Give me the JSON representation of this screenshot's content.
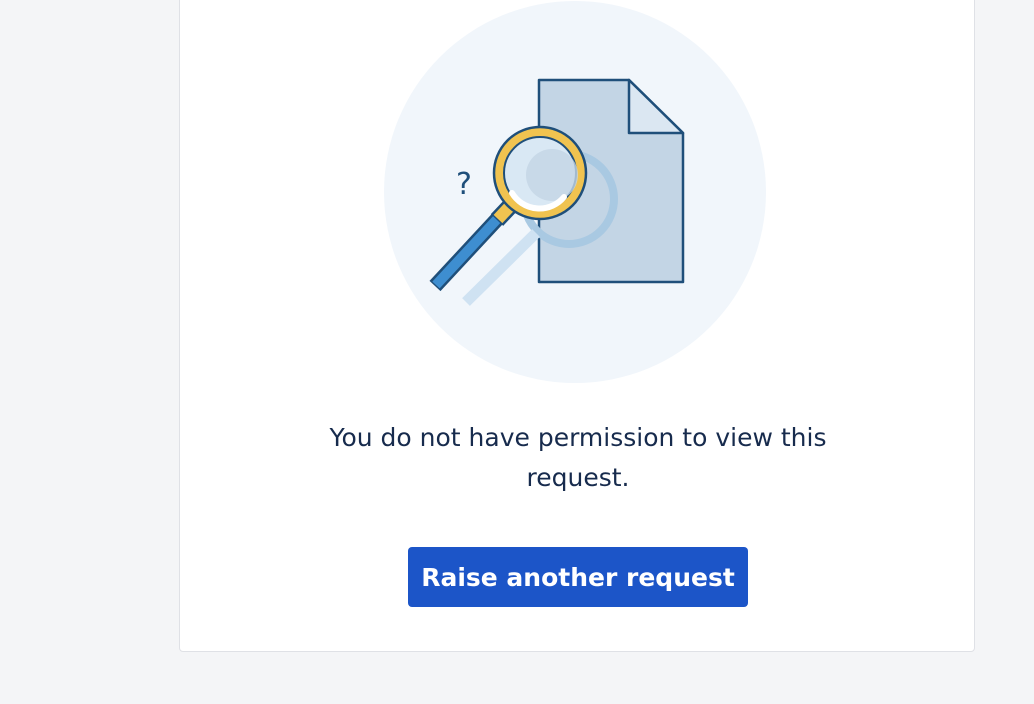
{
  "card": {
    "illustration_icon": "document-search-icon",
    "question_mark": "?",
    "message": "You do not have permission to view this request.",
    "raise_button_label": "Raise another request"
  },
  "colors": {
    "page_background": "#f4f5f7",
    "card_background": "#ffffff",
    "illustration_circle": "#f1f6fb",
    "document_fill": "#c3d5e5",
    "outline": "#1f4f7a",
    "magnifier_rim": "#f0c350",
    "magnifier_handle": "#3e8ed0",
    "text": "#172b4d",
    "button_background": "#1c55c8",
    "button_text": "#ffffff"
  }
}
